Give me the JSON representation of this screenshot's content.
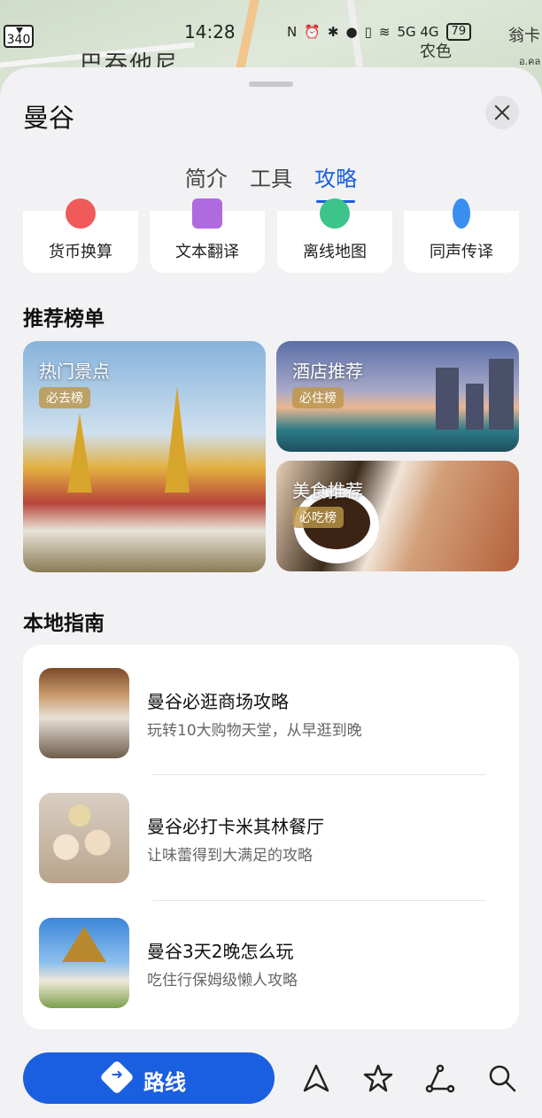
{
  "map": {
    "label_main": "巴吞他尼",
    "label_right": "农色",
    "label_right2": "翁卡",
    "label_right3": "อ.คล"
  },
  "status": {
    "route_number": "340",
    "time": "14:28",
    "battery": "79",
    "signal": "5G 4G"
  },
  "sheet": {
    "title": "曼谷"
  },
  "tabs": [
    {
      "label": "简介"
    },
    {
      "label": "工具"
    },
    {
      "label": "攻略",
      "active": true
    }
  ],
  "tools": [
    {
      "label": "货币换算",
      "icon": "currency-icon",
      "color": "#f05a5a"
    },
    {
      "label": "文本翻译",
      "icon": "translate-icon",
      "color": "#b06ae0"
    },
    {
      "label": "离线地图",
      "icon": "offline-map-icon",
      "color": "#3cc48a"
    },
    {
      "label": "同声传译",
      "icon": "interpret-icon",
      "color": "#3a8ef0"
    }
  ],
  "recommend": {
    "title": "推荐榜单",
    "cards": [
      {
        "title": "热门景点",
        "badge": "必去榜"
      },
      {
        "title": "酒店推荐",
        "badge": "必住榜"
      },
      {
        "title": "美食推荐",
        "badge": "必吃榜"
      }
    ]
  },
  "guide": {
    "title": "本地指南",
    "items": [
      {
        "title": "曼谷必逛商场攻略",
        "subtitle": "玩转10大购物天堂，从早逛到晚"
      },
      {
        "title": "曼谷必打卡米其林餐厅",
        "subtitle": "让味蕾得到大满足的攻略"
      },
      {
        "title": "曼谷3天2晚怎么玩",
        "subtitle": "吃住行保姆级懒人攻略"
      }
    ]
  },
  "bottom_bar": {
    "route_label": "路线"
  },
  "colors": {
    "accent": "#1a5fe0"
  }
}
